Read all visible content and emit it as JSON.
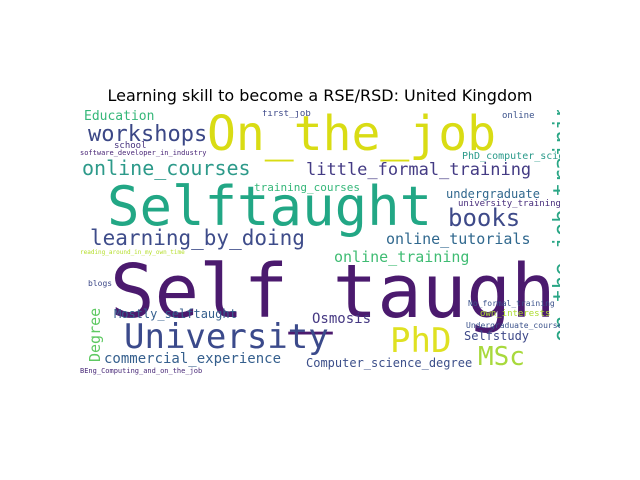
{
  "title": "Learning skill to become a RSE/RSD: United Kingdom",
  "words": [
    {
      "text": "Self_taught",
      "color": "#4b1a6e"
    },
    {
      "text": "Selftaught",
      "color": "#22a785"
    },
    {
      "text": "On_the_job",
      "color": "#d9dc14"
    },
    {
      "text": "University",
      "color": "#3b4a8b"
    },
    {
      "text": "PhD",
      "color": "#dfe122"
    },
    {
      "text": "MSc",
      "color": "#a8d93c"
    },
    {
      "text": "on_the_job_training",
      "color": "#29a685"
    },
    {
      "text": "workshops",
      "color": "#3b4786"
    },
    {
      "text": "online_courses",
      "color": "#2d9a8a"
    },
    {
      "text": "learning_by_doing",
      "color": "#3e4c8a"
    },
    {
      "text": "books",
      "color": "#3e4a89"
    },
    {
      "text": "little_formal_training",
      "color": "#443b84"
    },
    {
      "text": "online_tutorials",
      "color": "#30688e"
    },
    {
      "text": "online_training",
      "color": "#3fbc73"
    },
    {
      "text": "commercial_experience",
      "color": "#355f8d"
    },
    {
      "text": "Computer_science_degree",
      "color": "#3c4f8a"
    },
    {
      "text": "Osmosis",
      "color": "#453882"
    },
    {
      "text": "Selfstudy",
      "color": "#3e4989"
    },
    {
      "text": "Mostly_selftaught",
      "color": "#355f8d"
    },
    {
      "text": "Degree",
      "color": "#5ec962"
    },
    {
      "text": "Education",
      "color": "#35b779"
    },
    {
      "text": "training_courses",
      "color": "#35b779"
    },
    {
      "text": "undergraduate",
      "color": "#31688e"
    },
    {
      "text": "PhD_computer_science",
      "color": "#2a9a8a"
    },
    {
      "text": "university_training",
      "color": "#472d7b"
    },
    {
      "text": "own_interests",
      "color": "#addc30"
    },
    {
      "text": "Undergraduate_courses",
      "color": "#3b528b"
    },
    {
      "text": "No_formal_training",
      "color": "#3b528b"
    },
    {
      "text": "first_job",
      "color": "#3e4989"
    },
    {
      "text": "online",
      "color": "#3b528b"
    },
    {
      "text": "school",
      "color": "#46327e"
    },
    {
      "text": "software_developer_in_industry",
      "color": "#482576"
    },
    {
      "text": "blogs",
      "color": "#3e4989"
    },
    {
      "text": "BEng_Computing_and_on_the_job",
      "color": "#482878"
    },
    {
      "text": "reading_around_in_my_own_time",
      "color": "#b5de2b"
    }
  ]
}
